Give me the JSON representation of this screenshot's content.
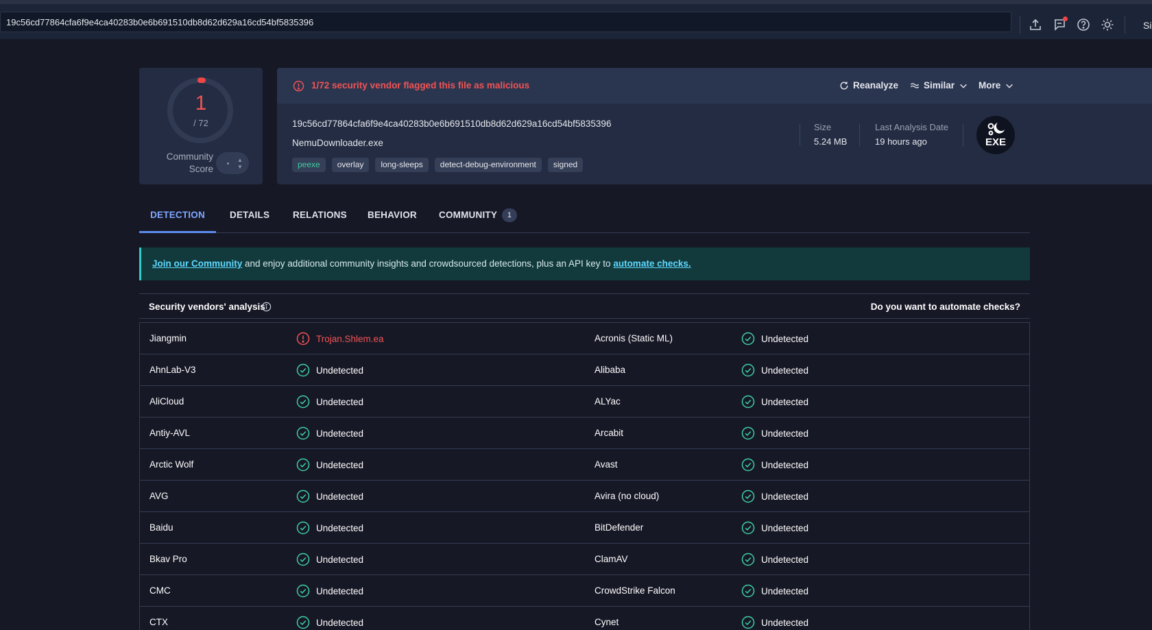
{
  "topbar": {
    "search_value": "19c56cd77864cfa6f9e4ca40283b0e6b691510db8d62d629a16cd54bf5835396",
    "signin_label": "Si",
    "icons": [
      "upload-icon",
      "chat-notification-icon",
      "help-icon",
      "theme-toggle-icon"
    ]
  },
  "score": {
    "detections": "1",
    "total": "/ 72",
    "community_label": "Community Score",
    "ratio": 0.0139
  },
  "summary": {
    "alert_text": "1/72 security vendor flagged this file as malicious",
    "reanalyze_label": "Reanalyze",
    "similar_label": "Similar",
    "more_label": "More",
    "hash": "19c56cd77864cfa6f9e4ca40283b0e6b691510db8d62d629a16cd54bf5835396",
    "file_name": "NemuDownloader.exe",
    "tags": [
      "peexe",
      "overlay",
      "long-sleeps",
      "detect-debug-environment",
      "signed"
    ],
    "size_label": "Size",
    "size_value": "5.24 MB",
    "last_analysis_label": "Last Analysis Date",
    "last_analysis_value": "19 hours ago",
    "file_type_badge": "EXE"
  },
  "tabs": [
    {
      "label": "DETECTION",
      "active": true
    },
    {
      "label": "DETAILS"
    },
    {
      "label": "RELATIONS"
    },
    {
      "label": "BEHAVIOR"
    },
    {
      "label": "COMMUNITY",
      "count": "1"
    }
  ],
  "banner": {
    "join_link": "Join our Community",
    "middle_text": " and enjoy additional community insights and crowdsourced detections, plus an API key to ",
    "automate_link": "automate checks."
  },
  "vendors": {
    "title": "Security vendors' analysis",
    "automate_question": "Do you want to automate checks?",
    "rows": [
      {
        "left": {
          "vendor": "Jiangmin",
          "result": "Trojan.Shlem.ea",
          "status": "malicious"
        },
        "right": {
          "vendor": "Acronis (Static ML)",
          "result": "Undetected",
          "status": "clean"
        }
      },
      {
        "left": {
          "vendor": "AhnLab-V3",
          "result": "Undetected",
          "status": "clean"
        },
        "right": {
          "vendor": "Alibaba",
          "result": "Undetected",
          "status": "clean"
        }
      },
      {
        "left": {
          "vendor": "AliCloud",
          "result": "Undetected",
          "status": "clean"
        },
        "right": {
          "vendor": "ALYac",
          "result": "Undetected",
          "status": "clean"
        }
      },
      {
        "left": {
          "vendor": "Antiy-AVL",
          "result": "Undetected",
          "status": "clean"
        },
        "right": {
          "vendor": "Arcabit",
          "result": "Undetected",
          "status": "clean"
        }
      },
      {
        "left": {
          "vendor": "Arctic Wolf",
          "result": "Undetected",
          "status": "clean"
        },
        "right": {
          "vendor": "Avast",
          "result": "Undetected",
          "status": "clean"
        }
      },
      {
        "left": {
          "vendor": "AVG",
          "result": "Undetected",
          "status": "clean"
        },
        "right": {
          "vendor": "Avira (no cloud)",
          "result": "Undetected",
          "status": "clean"
        }
      },
      {
        "left": {
          "vendor": "Baidu",
          "result": "Undetected",
          "status": "clean"
        },
        "right": {
          "vendor": "BitDefender",
          "result": "Undetected",
          "status": "clean"
        }
      },
      {
        "left": {
          "vendor": "Bkav Pro",
          "result": "Undetected",
          "status": "clean"
        },
        "right": {
          "vendor": "ClamAV",
          "result": "Undetected",
          "status": "clean"
        }
      },
      {
        "left": {
          "vendor": "CMC",
          "result": "Undetected",
          "status": "clean"
        },
        "right": {
          "vendor": "CrowdStrike Falcon",
          "result": "Undetected",
          "status": "clean"
        }
      },
      {
        "left": {
          "vendor": "CTX",
          "result": "Undetected",
          "status": "clean"
        },
        "right": {
          "vendor": "Cynet",
          "result": "Undetected",
          "status": "clean"
        }
      }
    ]
  },
  "colors": {
    "malicious": "#f25454",
    "clean": "#3ecfa4",
    "accent": "#5b8def"
  }
}
